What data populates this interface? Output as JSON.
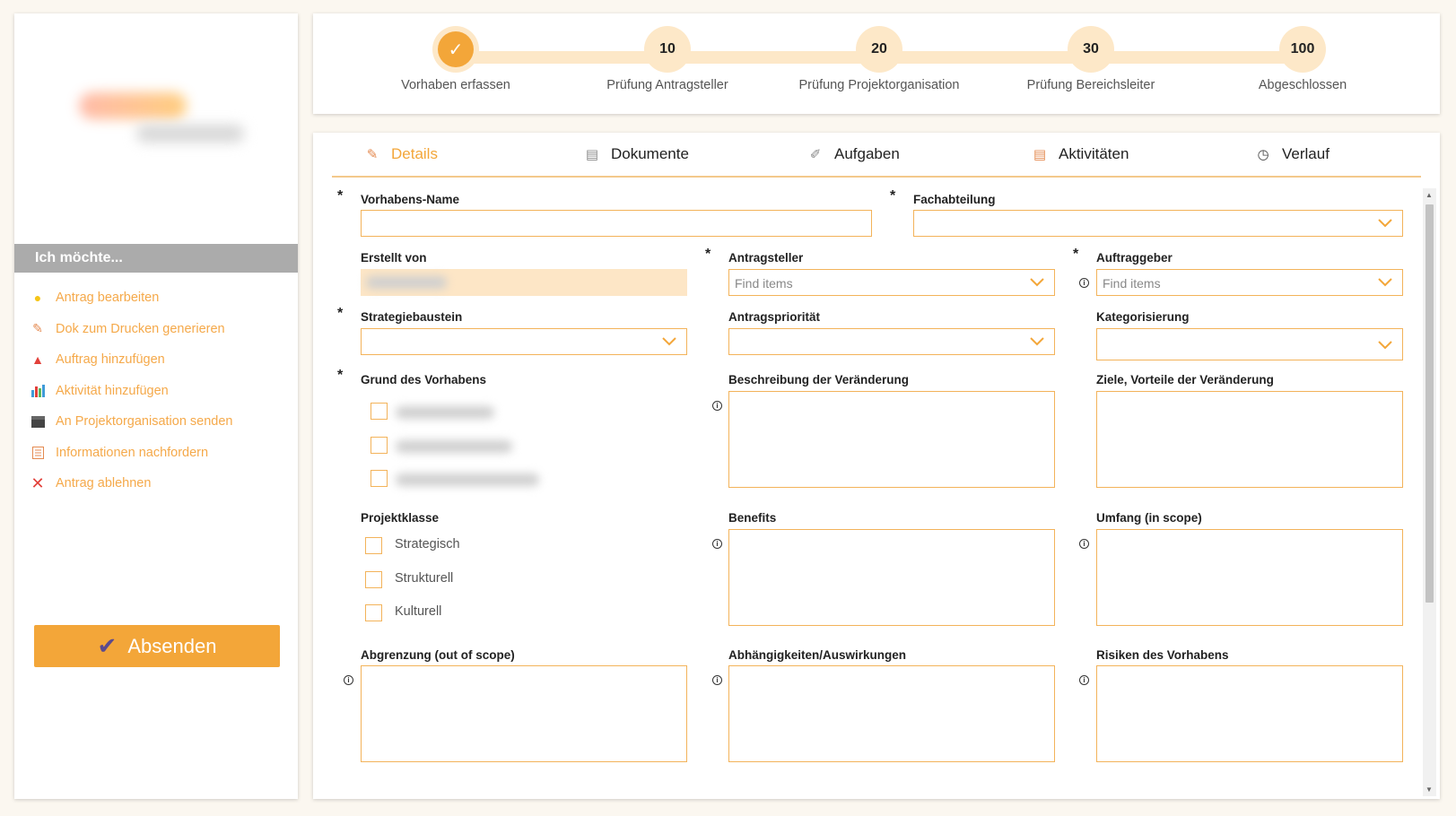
{
  "sidebar": {
    "menu_header": "Ich möchte...",
    "items": [
      {
        "label": "Antrag bearbeiten",
        "icon": "lightbulb-icon"
      },
      {
        "label": "Dok zum Drucken generieren",
        "icon": "edit-document-icon"
      },
      {
        "label": "Auftrag hinzufügen",
        "icon": "siren-icon"
      },
      {
        "label": "Aktivität hinzufügen",
        "icon": "bar-chart-icon"
      },
      {
        "label": "An Projektorganisation senden",
        "icon": "clapperboard-icon"
      },
      {
        "label": "Informationen nachfordern",
        "icon": "clipboard-icon"
      },
      {
        "label": "Antrag ablehnen",
        "icon": "cross-icon"
      }
    ],
    "submit_label": "Absenden"
  },
  "steps": [
    {
      "number": "",
      "label": "Vorhaben erfassen",
      "done": true
    },
    {
      "number": "10",
      "label": "Prüfung Antragsteller"
    },
    {
      "number": "20",
      "label": "Prüfung Projektorganisation"
    },
    {
      "number": "30",
      "label": "Prüfung Bereichsleiter"
    },
    {
      "number": "100",
      "label": "Abgeschlossen"
    }
  ],
  "tabs": [
    {
      "label": "Details",
      "icon": "edit-document-icon",
      "active": true
    },
    {
      "label": "Dokumente",
      "icon": "document-icon"
    },
    {
      "label": "Aufgaben",
      "icon": "pin-icon"
    },
    {
      "label": "Aktivitäten",
      "icon": "clipboard-icon"
    },
    {
      "label": "Verlauf",
      "icon": "clock-icon"
    }
  ],
  "form": {
    "vorhabens_name": {
      "label": "Vorhabens-Name",
      "value": ""
    },
    "fachabteilung": {
      "label": "Fachabteilung",
      "value": ""
    },
    "erstellt_von": {
      "label": "Erstellt von"
    },
    "antragsteller": {
      "label": "Antragsteller",
      "placeholder": "Find items"
    },
    "auftraggeber": {
      "label": "Auftraggeber",
      "placeholder": "Find items"
    },
    "strategiebaustein": {
      "label": "Strategiebaustein",
      "value": ""
    },
    "antragsprioritaet": {
      "label": "Antragspriorität",
      "value": ""
    },
    "kategorisierung": {
      "label": "Kategorisierung",
      "value": ""
    },
    "grund": {
      "label": "Grund des Vorhabens"
    },
    "beschreibung": {
      "label": "Beschreibung der Veränderung",
      "value": ""
    },
    "ziele": {
      "label": "Ziele, Vorteile der Veränderung",
      "value": ""
    },
    "projektklasse": {
      "label": "Projektklasse",
      "options": [
        "Strategisch",
        "Strukturell",
        "Kulturell"
      ]
    },
    "benefits": {
      "label": "Benefits",
      "value": ""
    },
    "umfang": {
      "label": "Umfang (in scope)",
      "value": ""
    },
    "abgrenzung": {
      "label": "Abgrenzung (out of scope)",
      "value": ""
    },
    "abhaengigkeiten": {
      "label": "Abhängigkeiten/Auswirkungen",
      "value": ""
    },
    "risiken": {
      "label": "Risiken des Vorhabens",
      "value": ""
    }
  },
  "colors": {
    "accent": "#f3a639",
    "accent_light": "#fde8c8",
    "field_border": "#f3b35a"
  }
}
